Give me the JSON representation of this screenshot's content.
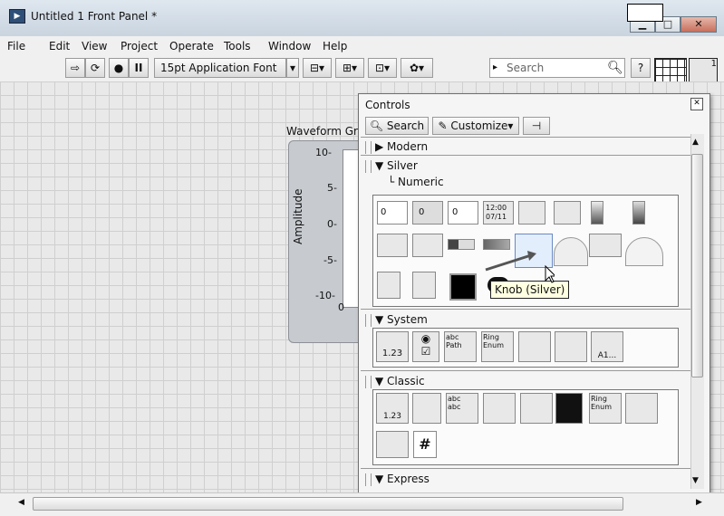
{
  "window": {
    "title": "Untitled 1 Front Panel *",
    "icon": "labview-icon",
    "controls": [
      "minimize-icon",
      "maximize-icon",
      "close-icon"
    ]
  },
  "menu": [
    "File",
    "Edit",
    "View",
    "Project",
    "Operate",
    "Tools",
    "Window",
    "Help"
  ],
  "toolbar": {
    "font_select": "15pt Application Font",
    "search_placeholder": "Search",
    "help_label": "?",
    "tools": [
      "run-arrow-icon",
      "run-continuous-icon",
      "abort-icon",
      "pause-icon",
      "align-icon",
      "distribute-icon",
      "resize-icon",
      "reorder-icon"
    ],
    "vi_icon_label": "1"
  },
  "graph": {
    "title": "Waveform Gra",
    "ylabel": "Amplitude",
    "yticks": [
      "10-",
      "5-",
      "0-",
      "-5-",
      "-10-"
    ],
    "xtick": "0"
  },
  "palette": {
    "title": "Controls",
    "search_label": "Search",
    "customize_label": "Customize▾",
    "sections": {
      "modern": "Modern",
      "silver": "Silver",
      "numeric": "└ Numeric",
      "system": "System",
      "classic": "Classic",
      "express": "Express"
    },
    "numeric_value": "0",
    "time_value": "12:00\n07/11",
    "tooltip": "Knob (Silver)",
    "system_value": "1.23",
    "system_text": "abc",
    "system_ring": "Ring",
    "system_enum": "Enum",
    "system_path": "Path",
    "system_a1": "A1...",
    "classic_value": "1.23",
    "classic_text": "abc",
    "classic_ring": "Ring",
    "classic_enum": "Enum"
  }
}
